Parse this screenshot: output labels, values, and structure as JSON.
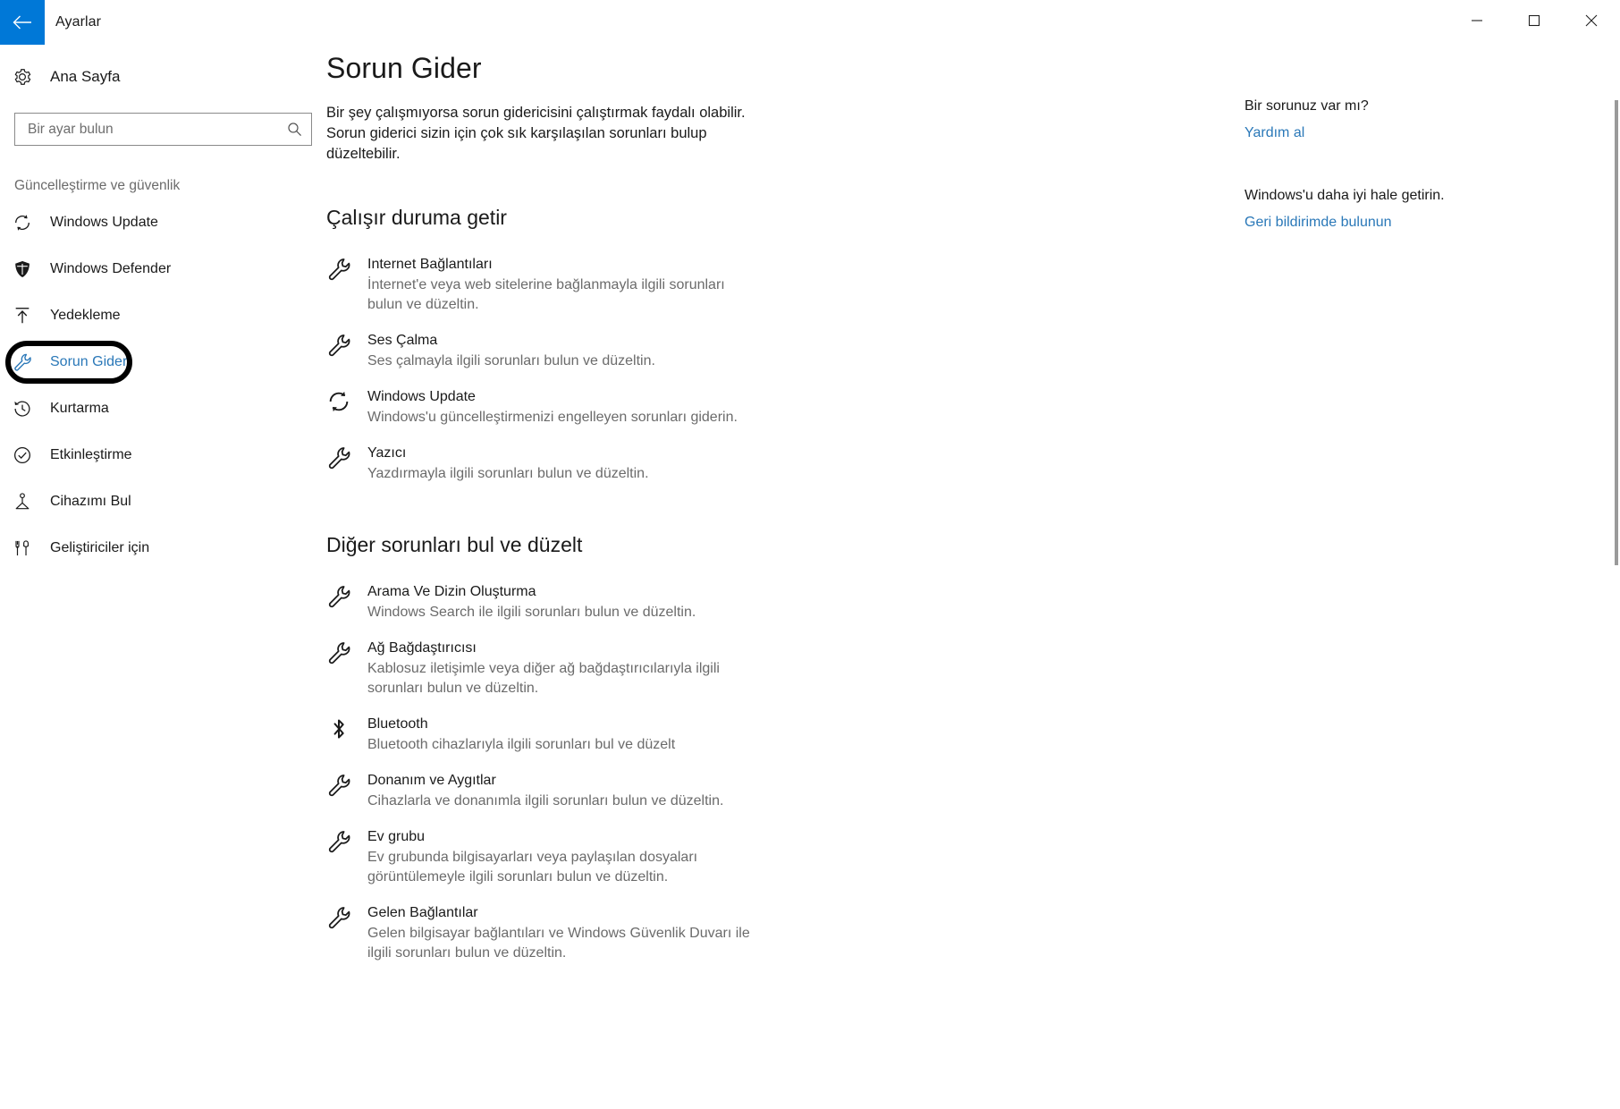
{
  "titlebar": {
    "back_icon": "back-arrow-icon",
    "app_title": "Ayarlar",
    "minimize_label": "—",
    "maximize_label": "☐",
    "close_label": "✕",
    "accent_color": "#0078d7"
  },
  "nav": {
    "home": {
      "icon": "gear-icon",
      "label": "Ana Sayfa"
    },
    "search": {
      "placeholder": "Bir ayar bulun",
      "value": "",
      "icon": "search-icon"
    },
    "section_title": "Güncelleştirme ve güvenlik",
    "items": [
      {
        "icon": "sync-icon",
        "label": "Windows Update",
        "selected": false
      },
      {
        "icon": "shield-icon",
        "label": "Windows Defender",
        "selected": false
      },
      {
        "icon": "upload-icon",
        "label": "Yedekleme",
        "selected": false
      },
      {
        "icon": "wrench-icon",
        "label": "Sorun Gider",
        "selected": true
      },
      {
        "icon": "history-icon",
        "label": "Kurtarma",
        "selected": false
      },
      {
        "icon": "check-circle-icon",
        "label": "Etkinleştirme",
        "selected": false
      },
      {
        "icon": "find-device-icon",
        "label": "Cihazımı Bul",
        "selected": false
      },
      {
        "icon": "developer-tools-icon",
        "label": "Geliştiriciler için",
        "selected": false
      }
    ],
    "selected_highlight_color": "#2a78b8",
    "annotation_ring_color": "#000000"
  },
  "main": {
    "page_title": "Sorun Gider",
    "intro": "Bir şey çalışmıyorsa sorun gidericisini çalıştırmak faydalı olabilir. Sorun giderici sizin için çok sık karşılaşılan sorunları bulup düzeltebilir.",
    "sections": [
      {
        "heading": "Çalışır duruma getir",
        "items": [
          {
            "icon": "wrench-icon",
            "name": "Internet Bağlantıları",
            "desc": "İnternet'e veya web sitelerine bağlanmayla ilgili sorunları bulun ve düzeltin."
          },
          {
            "icon": "wrench-icon",
            "name": "Ses Çalma",
            "desc": "Ses çalmayla ilgili sorunları bulun ve düzeltin."
          },
          {
            "icon": "sync-icon",
            "name": "Windows Update",
            "desc": "Windows'u güncelleştirmenizi engelleyen sorunları giderin."
          },
          {
            "icon": "wrench-icon",
            "name": "Yazıcı",
            "desc": "Yazdırmayla ilgili sorunları bulun ve düzeltin."
          }
        ]
      },
      {
        "heading": "Diğer sorunları bul ve düzelt",
        "items": [
          {
            "icon": "wrench-icon",
            "name": "Arama Ve Dizin Oluşturma",
            "desc": "Windows Search ile ilgili sorunları bulun ve düzeltin."
          },
          {
            "icon": "wrench-icon",
            "name": "Ağ Bağdaştırıcısı",
            "desc": "Kablosuz iletişimle veya diğer ağ bağdaştırıcılarıyla ilgili sorunları bulun ve düzeltin."
          },
          {
            "icon": "bluetooth-icon",
            "name": "Bluetooth",
            "desc": "Bluetooth cihazlarıyla ilgili sorunları bul ve düzelt"
          },
          {
            "icon": "wrench-icon",
            "name": "Donanım ve Aygıtlar",
            "desc": "Cihazlarla ve donanımla ilgili sorunları bulun ve düzeltin."
          },
          {
            "icon": "wrench-icon",
            "name": "Ev grubu",
            "desc": "Ev grubunda bilgisayarları veya paylaşılan dosyaları görüntülemeyle ilgili sorunları bulun ve düzeltin."
          },
          {
            "icon": "wrench-icon",
            "name": "Gelen Bağlantılar",
            "desc": "Gelen bilgisayar bağlantıları ve Windows Güvenlik Duvarı ile ilgili sorunları bulun ve düzeltin."
          }
        ]
      }
    ]
  },
  "rail": {
    "blocks": [
      {
        "heading": "Bir sorunuz var mı?",
        "link": "Yardım al"
      },
      {
        "heading": "Windows'u daha iyi hale getirin.",
        "link": "Geri bildirimde bulunun"
      }
    ],
    "link_color": "#2a78b8"
  }
}
